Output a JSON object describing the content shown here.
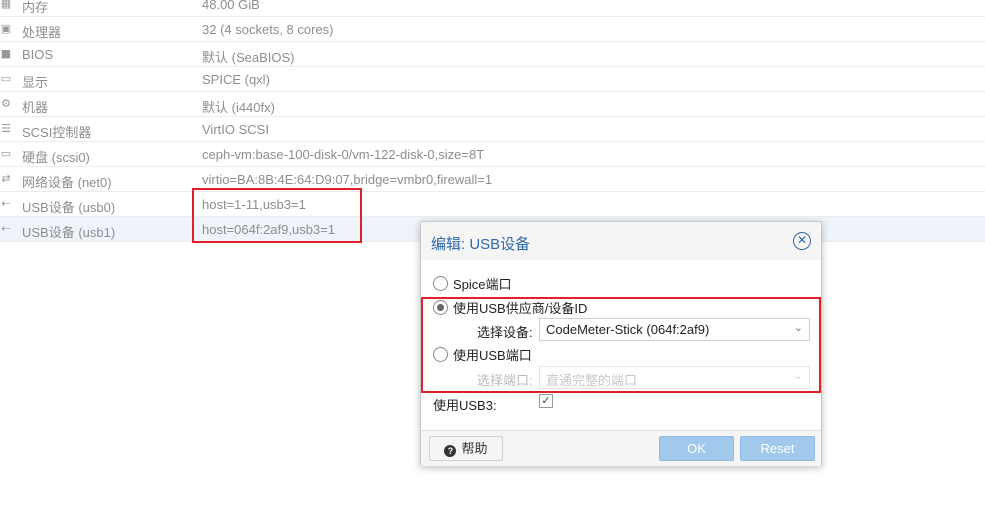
{
  "hardware": [
    {
      "icon": "memory-icon",
      "name": "内存",
      "value": "48.00 GiB"
    },
    {
      "icon": "cpu-icon",
      "name": "处理器",
      "value": "32 (4 sockets, 8 cores)"
    },
    {
      "icon": "bios-icon",
      "name": "BIOS",
      "value": "默认 (SeaBIOS)"
    },
    {
      "icon": "display-icon",
      "name": "显示",
      "value": "SPICE (qxl)"
    },
    {
      "icon": "machine-icon",
      "name": "机器",
      "value": "默认 (i440fx)"
    },
    {
      "icon": "database-icon",
      "name": "SCSI控制器",
      "value": "VirtIO SCSI"
    },
    {
      "icon": "harddisk-icon",
      "name": "硬盘 (scsi0)",
      "value": "ceph-vm:base-100-disk-0/vm-122-disk-0,size=8T"
    },
    {
      "icon": "network-icon",
      "name": "网络设备 (net0)",
      "value": "virtio=BA:8B:4E:64:D9:07,bridge=vmbr0,firewall=1"
    },
    {
      "icon": "usb-icon",
      "name": "USB设备 (usb0)",
      "value": "host=1-11,usb3=1"
    },
    {
      "icon": "usb-icon",
      "name": "USB设备 (usb1)",
      "value": "host=064f:2af9,usb3=1"
    }
  ],
  "dialog": {
    "title": "编辑: USB设备",
    "options": {
      "spice": "Spice端口",
      "vendor": "使用USB供应商/设备ID",
      "port": "使用USB端口"
    },
    "selected_option": "vendor",
    "device_label": "选择设备:",
    "device_value": "CodeMeter-Stick (064f:2af9)",
    "port_label": "选择端口:",
    "port_placeholder": "直通完整的端口",
    "usb3_label": "使用USB3:",
    "usb3_checked": true,
    "buttons": {
      "help": "帮助",
      "ok": "OK",
      "reset": "Reset"
    }
  },
  "colors": {
    "accent": "#2e6aa8",
    "highlight": "#e0202a",
    "button": "#a2c8eb"
  }
}
